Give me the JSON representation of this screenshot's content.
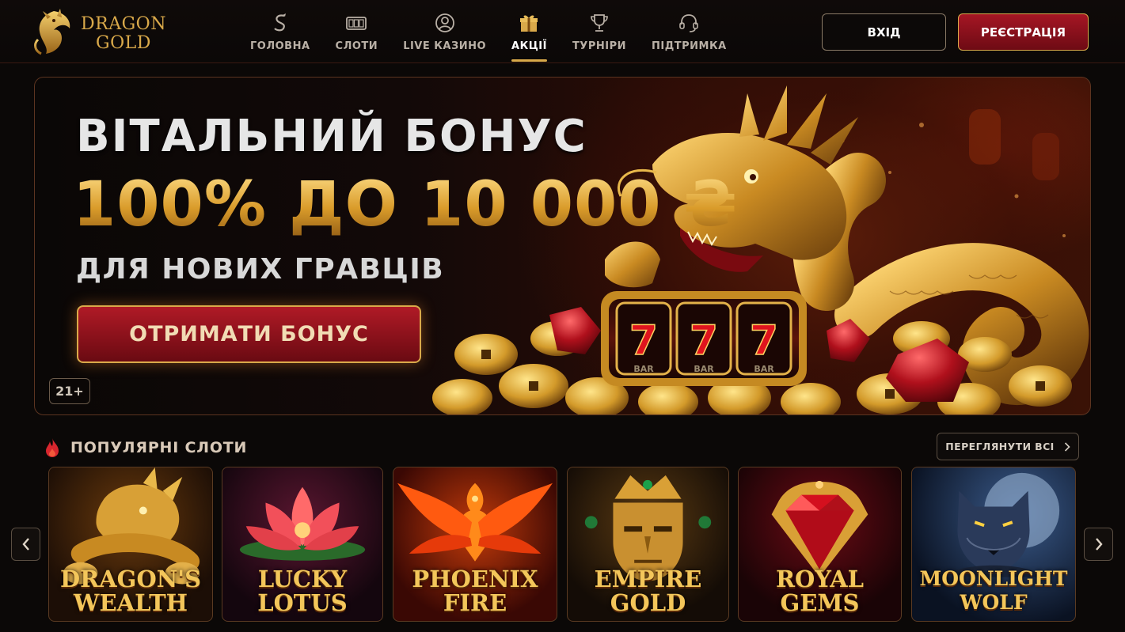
{
  "brand": {
    "line1": "DRAGON",
    "line2": "GOLD"
  },
  "nav": [
    {
      "label": "ГОЛОВНА",
      "icon": "dragon-s-icon",
      "active": false
    },
    {
      "label": "СЛОТИ",
      "icon": "slot-machine-icon",
      "active": false
    },
    {
      "label": "LIVE КАЗИНО",
      "icon": "user-circle-icon",
      "active": false
    },
    {
      "label": "АКЦІЇ",
      "icon": "gift-icon",
      "active": true
    },
    {
      "label": "ТУРНІРИ",
      "icon": "trophy-icon",
      "active": false
    },
    {
      "label": "ПІДТРИМКА",
      "icon": "headset-icon",
      "active": false
    }
  ],
  "auth": {
    "login": "ВХІД",
    "register": "РЕЄСТРАЦІЯ"
  },
  "hero": {
    "title": "ВІТАЛЬНИЙ БОНУС",
    "amount": "100% ДО 10 000 ₴",
    "subtitle": "ДЛЯ НОВИХ ГРАВЦІВ",
    "cta": "ОТРИМАТИ БОНУС",
    "age": "21+",
    "reels": [
      "7",
      "7",
      "7"
    ],
    "reel_sub": [
      "BAR",
      "BAR",
      "BAR"
    ]
  },
  "slots_section": {
    "title": "ПОПУЛЯРНІ СЛОТИ",
    "see_all": "ПЕРЕГЛЯНУТИ ВСІ",
    "items": [
      {
        "line1": "DRAGON'S",
        "line2": "WEALTH",
        "theme": "dragon"
      },
      {
        "line1": "LUCKY",
        "line2": "LOTUS",
        "theme": "lotus"
      },
      {
        "line1": "PHOENIX",
        "line2": "FIRE",
        "theme": "phoenix"
      },
      {
        "line1": "EMPIRE",
        "line2": "GOLD",
        "theme": "mask"
      },
      {
        "line1": "ROYAL",
        "line2": "GEMS",
        "theme": "gem"
      },
      {
        "line1": "MOONLIGHT",
        "line2": "WOLF",
        "theme": "wolf"
      }
    ]
  },
  "colors": {
    "gold": "#d9a94a",
    "red": "#a51624",
    "bg": "#0b0807"
  }
}
